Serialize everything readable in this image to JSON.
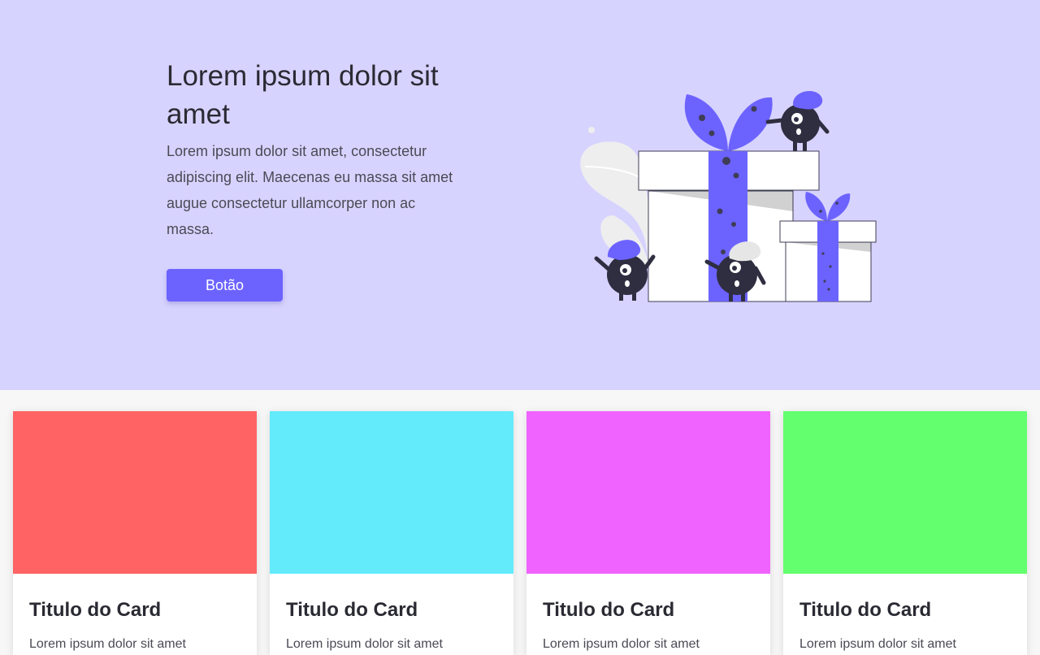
{
  "hero": {
    "title": "Lorem ipsum dolor sit amet",
    "description": "Lorem ipsum dolor sit amet, consectetur adipiscing elit. Maecenas eu massa sit amet augue consectetur ullamcorper non ac massa.",
    "button_label": "Botão",
    "background_color": "#d7d3ff",
    "accent_color": "#6c63ff",
    "illustration_icon": "gift-boxes-with-monsters-illustration"
  },
  "cards": [
    {
      "title": "Titulo do Card",
      "text": "Lorem ipsum dolor sit amet",
      "image_color": "#ff6363"
    },
    {
      "title": "Titulo do Card",
      "text": "Lorem ipsum dolor sit amet",
      "image_color": "#63ebfc"
    },
    {
      "title": "Titulo do Card",
      "text": "Lorem ipsum dolor sit amet",
      "image_color": "#f063ff"
    },
    {
      "title": "Titulo do Card",
      "text": "Lorem ipsum dolor sit amet",
      "image_color": "#63ff6f"
    }
  ]
}
